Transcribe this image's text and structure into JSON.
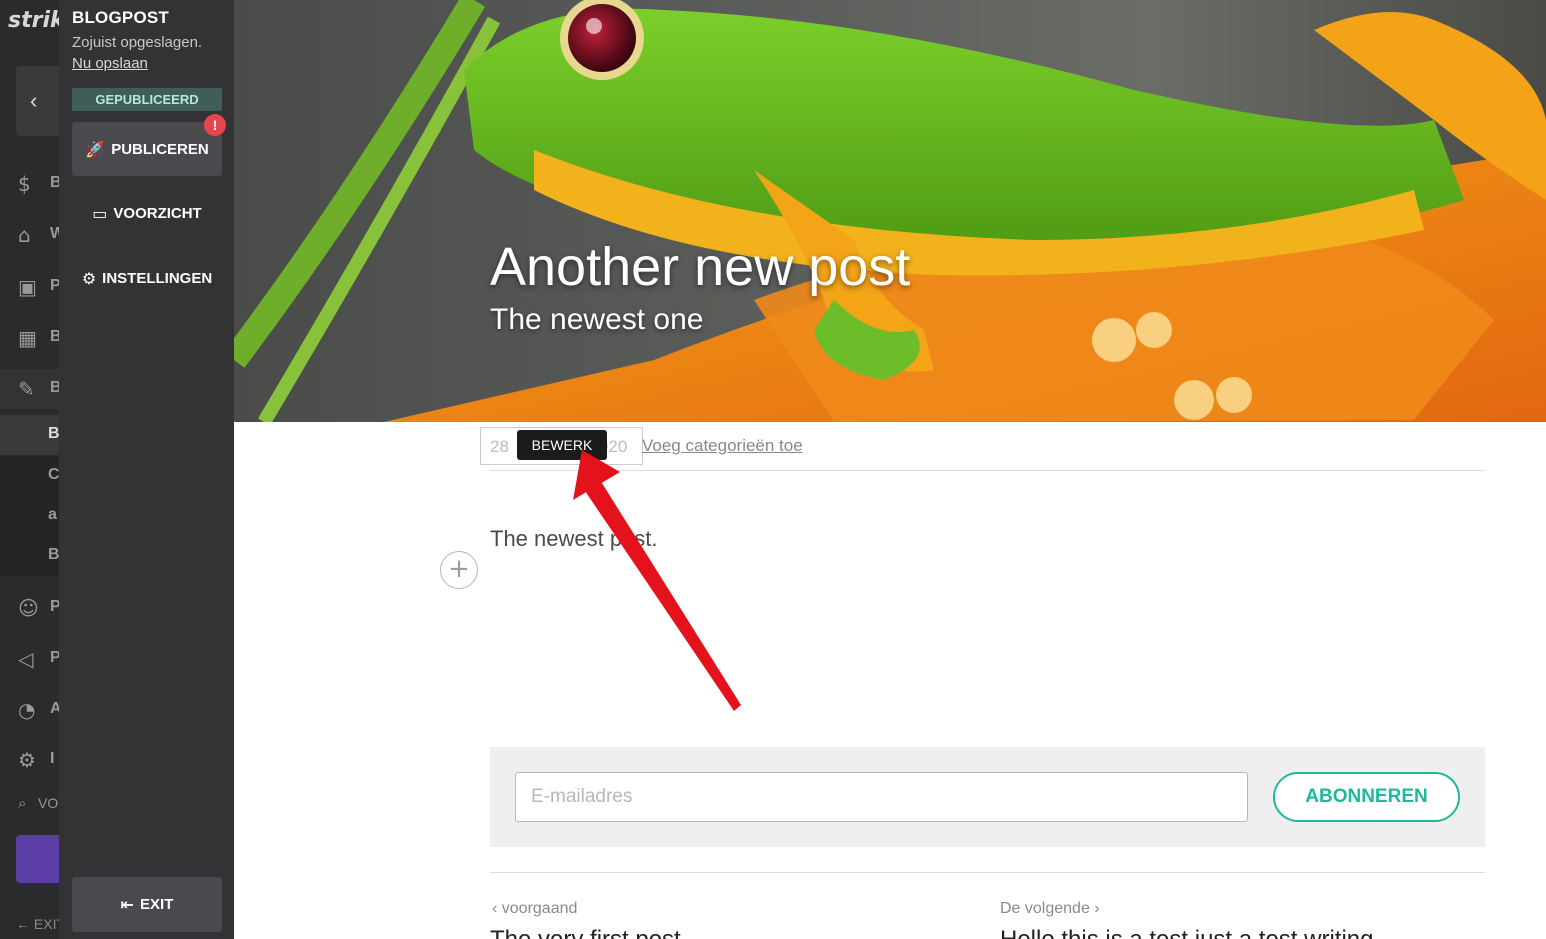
{
  "app": {
    "logo": "strik",
    "nav_rows": [
      "B",
      "W",
      "P",
      "B",
      "B"
    ],
    "sub_rows": [
      "B",
      "C",
      "a",
      "B"
    ],
    "nav_rows_2": [
      "P",
      "P",
      "A",
      "I"
    ],
    "search_label": "VO",
    "exit_label": "EXIT"
  },
  "panel": {
    "title": "BLOGPOST",
    "saved_text": "Zojuist opgeslagen.",
    "save_now": "Nu opslaan",
    "status": "GEPUBLICEERD",
    "publish_label": "PUBLICEREN",
    "publish_badge": "!",
    "preview_label": "VOORZICHT",
    "settings_label": "INSTELLINGEN",
    "exit_label": "EXIT"
  },
  "post": {
    "title": "Another new post",
    "subtitle": "The newest one",
    "date_visible": "28",
    "date_year_visible": "020",
    "edit_tooltip": "BEWERK",
    "add_categories": "Voeg categorieën toe",
    "body": "The newest post.",
    "add_block": "+"
  },
  "subscribe": {
    "email_placeholder": "E-mailadres",
    "button_label": "ABONNEREN"
  },
  "post_nav": {
    "prev_label": "voorgaand",
    "next_label": "De volgende",
    "prev_title": "The very first post",
    "next_title": "Hello this is a test just a test writing"
  },
  "colors": {
    "accent": "#1fb89b",
    "panel": "#333336",
    "badge": "#e8444e",
    "arrow": "#e3121b"
  }
}
